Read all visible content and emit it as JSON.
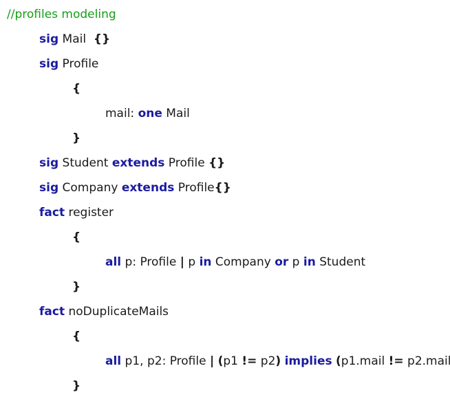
{
  "comment": "//profiles modeling",
  "lines": [
    {
      "segs": [
        {
          "t": "sig",
          "k": "kw"
        },
        {
          "t": " Mail  ",
          "k": "tx"
        },
        {
          "t": "{}",
          "k": "br"
        }
      ]
    },
    {
      "segs": [
        {
          "t": "sig",
          "k": "kw"
        },
        {
          "t": " Profile",
          "k": "tx"
        }
      ]
    },
    {
      "segs": [
        {
          "t": "{",
          "k": "br"
        }
      ]
    },
    {
      "segs": [
        {
          "t": "mail: ",
          "k": "tx"
        },
        {
          "t": "one",
          "k": "kw"
        },
        {
          "t": " Mail",
          "k": "tx"
        }
      ]
    },
    {
      "segs": [
        {
          "t": "}",
          "k": "br"
        }
      ]
    },
    {
      "segs": [
        {
          "t": "sig",
          "k": "kw"
        },
        {
          "t": " Student ",
          "k": "tx"
        },
        {
          "t": "extends",
          "k": "kw"
        },
        {
          "t": " Profile ",
          "k": "tx"
        },
        {
          "t": "{}",
          "k": "br"
        }
      ]
    },
    {
      "segs": [
        {
          "t": "sig",
          "k": "kw"
        },
        {
          "t": " Company ",
          "k": "tx"
        },
        {
          "t": "extends",
          "k": "kw"
        },
        {
          "t": " Profile",
          "k": "tx"
        },
        {
          "t": "{}",
          "k": "br"
        }
      ]
    },
    {
      "segs": [
        {
          "t": "fact",
          "k": "kw"
        },
        {
          "t": " register",
          "k": "tx"
        }
      ]
    },
    {
      "segs": [
        {
          "t": "{",
          "k": "br"
        }
      ]
    },
    {
      "segs": [
        {
          "t": "all",
          "k": "kw"
        },
        {
          "t": " p: Profile ",
          "k": "tx"
        },
        {
          "t": "|",
          "k": "br"
        },
        {
          "t": " p ",
          "k": "tx"
        },
        {
          "t": "in",
          "k": "kw"
        },
        {
          "t": " Company ",
          "k": "tx"
        },
        {
          "t": "or",
          "k": "kw"
        },
        {
          "t": " p ",
          "k": "tx"
        },
        {
          "t": "in",
          "k": "kw"
        },
        {
          "t": " Student",
          "k": "tx"
        }
      ]
    },
    {
      "segs": [
        {
          "t": "}",
          "k": "br"
        }
      ]
    },
    {
      "segs": [
        {
          "t": "fact",
          "k": "kw"
        },
        {
          "t": " noDuplicateMails",
          "k": "tx"
        }
      ]
    },
    {
      "segs": [
        {
          "t": "{",
          "k": "br"
        }
      ]
    },
    {
      "segs": [
        {
          "t": "all",
          "k": "kw"
        },
        {
          "t": " p1, p2: Profile ",
          "k": "tx"
        },
        {
          "t": "|",
          "k": "br"
        },
        {
          "t": " ",
          "k": "tx"
        },
        {
          "t": "(",
          "k": "br"
        },
        {
          "t": "p1 ",
          "k": "tx"
        },
        {
          "t": "!=",
          "k": "br"
        },
        {
          "t": " p2",
          "k": "tx"
        },
        {
          "t": ")",
          "k": "br"
        },
        {
          "t": " ",
          "k": "tx"
        },
        {
          "t": "implies",
          "k": "kw"
        },
        {
          "t": " ",
          "k": "tx"
        },
        {
          "t": "(",
          "k": "br"
        },
        {
          "t": "p1.mail ",
          "k": "tx"
        },
        {
          "t": "!=",
          "k": "br"
        },
        {
          "t": " p2.mail",
          "k": "tx"
        },
        {
          "t": ")",
          "k": "br"
        }
      ]
    },
    {
      "segs": [
        {
          "t": "}",
          "k": "br"
        }
      ]
    }
  ],
  "colors": {
    "keyword": "#1b1ba0",
    "comment": "#14a014",
    "text": "#1a1a1a"
  }
}
